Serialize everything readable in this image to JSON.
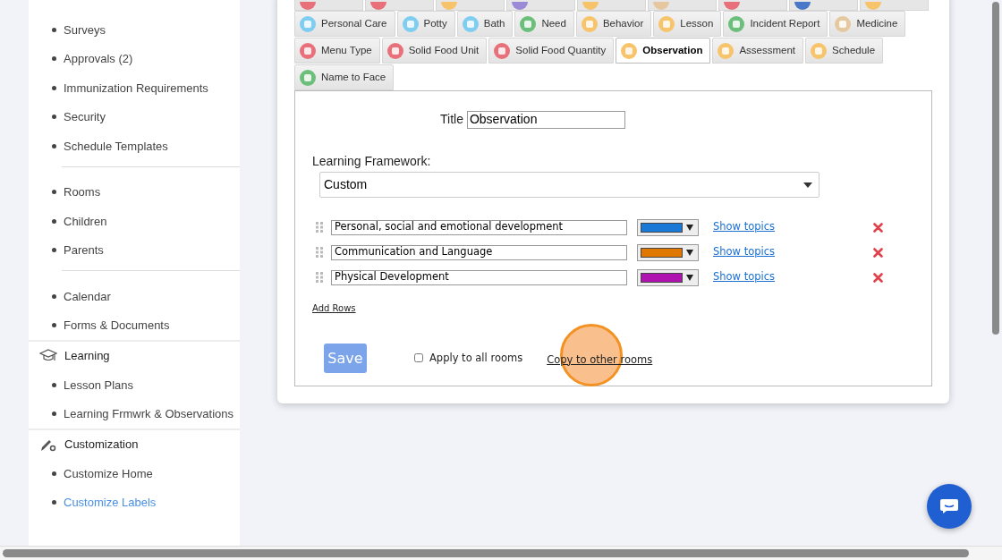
{
  "sidebar": {
    "sections": [
      {
        "items": [
          {
            "label": "Surveys",
            "selected": false
          },
          {
            "label": "Approvals (2)",
            "selected": false
          },
          {
            "label": "Immunization Requirements",
            "selected": false
          },
          {
            "label": "Security",
            "selected": false
          },
          {
            "label": "Schedule Templates",
            "selected": false
          }
        ]
      },
      {
        "items": [
          {
            "label": "Rooms",
            "selected": false
          },
          {
            "label": "Children",
            "selected": false
          },
          {
            "label": "Parents",
            "selected": false
          }
        ]
      },
      {
        "items": [
          {
            "label": "Calendar",
            "selected": false
          },
          {
            "label": "Forms & Documents",
            "selected": false
          }
        ]
      },
      {
        "heading": "Learning",
        "kind": "cap",
        "items": [
          {
            "label": "Lesson Plans",
            "selected": false
          },
          {
            "label": "Learning Frmwrk & Observations",
            "selected": false
          }
        ]
      },
      {
        "heading": "Customization",
        "kind": "tools",
        "items": [
          {
            "label": "Customize Home",
            "selected": false
          },
          {
            "label": "Customize Labels",
            "selected": true
          }
        ]
      }
    ]
  },
  "tab_stubs": [
    {
      "color": "#e8707a"
    },
    {
      "color": "#e8707a"
    },
    {
      "color": "#f7c46c"
    },
    {
      "color": "#9b8ad6"
    },
    {
      "color": "#f7c46c"
    },
    {
      "color": "#e6c8a0"
    },
    {
      "color": "#e8707a"
    },
    {
      "color": "#4a78c8"
    },
    {
      "color": "#f7c46c"
    }
  ],
  "tabs": [
    [
      {
        "label": "Personal Care",
        "color": "#7fcdf0",
        "selected": false
      },
      {
        "label": "Potty",
        "color": "#7fcdf0",
        "selected": false
      },
      {
        "label": "Bath",
        "color": "#7fcdf0",
        "selected": false
      },
      {
        "label": "Need",
        "color": "#6cbf7a",
        "selected": false
      },
      {
        "label": "Behavior",
        "color": "#f7c46c",
        "selected": false
      },
      {
        "label": "Lesson",
        "color": "#f7c46c",
        "selected": false
      },
      {
        "label": "Incident Report",
        "color": "#6cbf7a",
        "selected": false
      },
      {
        "label": "Medicine",
        "color": "#e6c8a0",
        "selected": false
      }
    ],
    [
      {
        "label": "Menu Type",
        "color": "#e8707a",
        "selected": false
      },
      {
        "label": "Solid Food Unit",
        "color": "#e8707a",
        "selected": false
      },
      {
        "label": "Solid Food Quantity",
        "color": "#e8707a",
        "selected": false
      },
      {
        "label": "Observation",
        "color": "#f7c46c",
        "selected": true
      },
      {
        "label": "Assessment",
        "color": "#f7c46c",
        "selected": false
      },
      {
        "label": "Schedule",
        "color": "#f7c46c",
        "selected": false
      }
    ],
    [
      {
        "label": "Name to Face",
        "color": "#6cbf7a",
        "selected": false
      }
    ]
  ],
  "form": {
    "title_label": "Title",
    "title_value": "Observation",
    "framework_label": "Learning Framework:",
    "framework_value": "Custom",
    "rows": [
      {
        "name": "Personal, social and emotional development",
        "color": "#1a78d6",
        "link": "Show topics"
      },
      {
        "name": "Communication and Language",
        "color": "#e07800",
        "link": "Show topics"
      },
      {
        "name": "Physical Development",
        "color": "#b014b0",
        "link": "Show topics"
      }
    ],
    "add_rows": "Add Rows",
    "save": "Save",
    "apply_all": {
      "label": "Apply to all rooms",
      "checked": false
    },
    "copy": "Copy to other rooms"
  }
}
